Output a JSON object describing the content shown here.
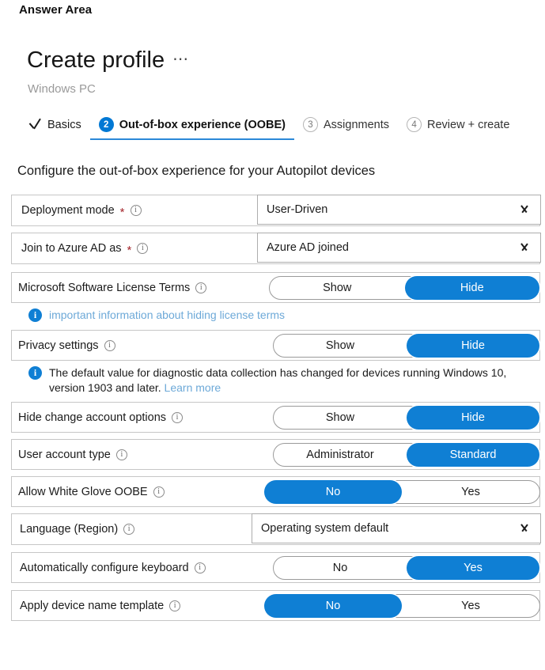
{
  "answer_area_label": "Answer Area",
  "blade": {
    "title": "Create profile",
    "ellipsis": "⋯",
    "subtitle": "Windows PC"
  },
  "tabs": [
    {
      "label": "Basics",
      "marker": "check",
      "state": "done"
    },
    {
      "label": "Out-of-box experience (OOBE)",
      "marker": "2",
      "state": "active"
    },
    {
      "label": "Assignments",
      "marker": "3",
      "state": "future"
    },
    {
      "label": "Review + create",
      "marker": "4",
      "state": "future"
    }
  ],
  "section_heading": "Configure the out-of-box experience for your Autopilot devices",
  "icons": {
    "info": "i",
    "info_filled": "i",
    "chevron_down": "chevron-down",
    "check": "check"
  },
  "colors": {
    "accent": "#0f7fd4",
    "tab_underline": "#2b88d8",
    "required_star": "#a4262c",
    "link": "#6da9d8",
    "border": "#c6c6c6"
  },
  "rows": [
    {
      "id": "deployment-mode",
      "label": "Deployment mode",
      "required": true,
      "control": "dropdown",
      "value": "User-Driven"
    },
    {
      "id": "join-to-azure-ad-as",
      "label": "Join to Azure AD as",
      "required": true,
      "control": "dropdown",
      "value": "Azure AD joined"
    },
    {
      "id": "microsoft-software-license-terms",
      "label": "Microsoft Software License Terms",
      "required": false,
      "control": "toggle",
      "options": [
        "Show",
        "Hide"
      ],
      "selected": "Hide"
    },
    {
      "id": "privacy-settings",
      "label": "Privacy settings",
      "required": false,
      "control": "toggle",
      "options": [
        "Show",
        "Hide"
      ],
      "selected": "Hide"
    },
    {
      "id": "hide-change-account-options",
      "label": "Hide change account options",
      "required": false,
      "control": "toggle",
      "options": [
        "Show",
        "Hide"
      ],
      "selected": "Hide"
    },
    {
      "id": "user-account-type",
      "label": "User account type",
      "required": false,
      "control": "toggle",
      "options": [
        "Administrator",
        "Standard"
      ],
      "selected": "Standard"
    },
    {
      "id": "allow-white-glove-oobe",
      "label": "Allow White Glove OOBE",
      "required": false,
      "control": "toggle",
      "options": [
        "No",
        "Yes"
      ],
      "selected": "No"
    },
    {
      "id": "language-region",
      "label": "Language (Region)",
      "required": false,
      "control": "dropdown",
      "value": "Operating system default"
    },
    {
      "id": "automatically-configure-keyboard",
      "label": "Automatically configure keyboard",
      "required": false,
      "control": "toggle",
      "options": [
        "No",
        "Yes"
      ],
      "selected": "Yes"
    },
    {
      "id": "apply-device-name-template",
      "label": "Apply device name template",
      "required": false,
      "control": "toggle",
      "options": [
        "No",
        "Yes"
      ],
      "selected": "No"
    }
  ],
  "notes": {
    "license_terms": {
      "text": "important information about hiding license terms"
    },
    "privacy": {
      "text": "The default value for diagnostic data collection has changed for devices running Windows 10, version 1903 and later.",
      "link": "Learn more"
    }
  }
}
